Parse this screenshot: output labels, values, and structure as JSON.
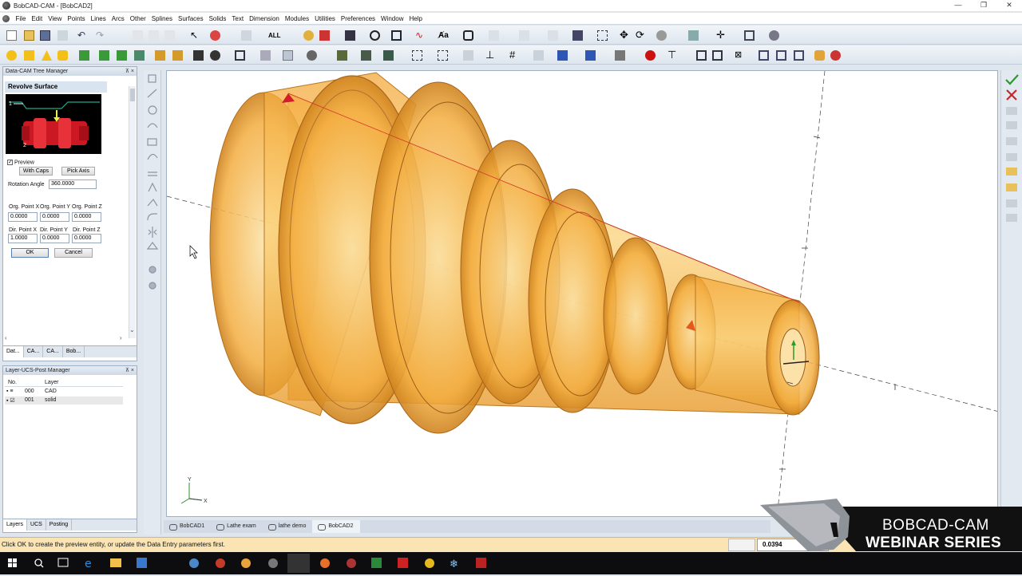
{
  "window": {
    "title": "BobCAD-CAM - [BobCAD2]",
    "controls": [
      "—",
      "❐",
      "✕"
    ]
  },
  "menu": [
    "File",
    "Edit",
    "View",
    "Points",
    "Lines",
    "Arcs",
    "Other",
    "Splines",
    "Surfaces",
    "Solids",
    "Text",
    "Dimension",
    "Modules",
    "Utilities",
    "Preferences",
    "Window",
    "Help"
  ],
  "toolbar": {
    "filter_label": "ALL",
    "text_label": "Aa"
  },
  "tree_manager": {
    "header": "Data-CAM Tree Manager",
    "pin": "⊼ ×",
    "title": "Revolve Surface",
    "preview_label": "Preview",
    "with_caps": "With Caps",
    "pick_axis": "Pick Axis",
    "rotation_label": "Rotation Angle",
    "rotation_value": "360.0000",
    "org_x_label": "Org. Point X",
    "org_y_label": "Org. Point Y",
    "org_z_label": "Org. Point Z",
    "org_x": "0.0000",
    "org_y": "0.0000",
    "org_z": "0.0000",
    "dir_x_label": "Dir. Point X",
    "dir_y_label": "Dir. Point Y",
    "dir_z_label": "Dir. Point Z",
    "dir_x": "1.0000",
    "dir_y": "0.0000",
    "dir_z": "0.0000",
    "ok": "OK",
    "cancel": "Cancel",
    "tabs": [
      "Dat...",
      "CA...",
      "CA...",
      "Bob..."
    ]
  },
  "layer_manager": {
    "header": "Layer-UCS-Post Manager",
    "col_no": "No.",
    "col_layer": "Layer",
    "rows": [
      {
        "no": "000",
        "layer": "CAD"
      },
      {
        "no": "001",
        "layer": "solid"
      }
    ],
    "tabs": [
      "Layers",
      "UCS",
      "Posting"
    ]
  },
  "document_tabs": [
    "BobCAD1",
    "Lathe exam",
    "lathe demo",
    "BobCAD2"
  ],
  "status": {
    "message": "Click OK to create the preview entity, or update the Data Entry parameters first.",
    "coord": "0.0394"
  },
  "brand": {
    "line1": "BOBCAD-CAM",
    "line2": "WEBINAR SERIES"
  },
  "axis": {
    "x": "X",
    "y": "Y"
  },
  "colors": {
    "accent": "#f2a531",
    "part_fill": "#f5b84a",
    "part_edge": "#b5741a",
    "status_bg": "#fbe4b4"
  }
}
